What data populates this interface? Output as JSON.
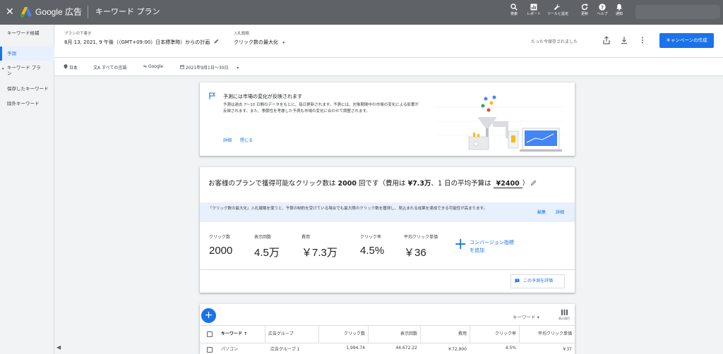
{
  "topbar": {
    "close_glyph": "✕",
    "brand": "Google 広告",
    "tool_name": "キーワード プラン",
    "icons": [
      {
        "name": "search-icon",
        "label": "検索"
      },
      {
        "name": "reports-icon",
        "label": "レポート"
      },
      {
        "name": "tools-icon",
        "label": "ツールと設定"
      },
      {
        "name": "refresh-icon",
        "label": "更新"
      },
      {
        "name": "help-icon",
        "label": "ヘルプ"
      },
      {
        "name": "notifications-icon",
        "label": "通知"
      }
    ],
    "logo_colors": {
      "blue": "#4285f4",
      "yellow": "#fbbc04",
      "green": "#34a853"
    }
  },
  "sidebar": {
    "items": [
      {
        "label": "キーワード候補"
      },
      {
        "label": "予測"
      },
      {
        "label": "キーワード プラン"
      },
      {
        "label": "保存したキーワード"
      },
      {
        "label": "除外キーワード"
      }
    ],
    "collapse_glyph": "◀"
  },
  "header": {
    "plan_label": "プランの下書き",
    "plan_title": "8月 13, 2021, 9 午後（（GMT+09:00）日本標準時）からの計画",
    "bid_label": "入札戦略",
    "bid_value": "クリック数の最大化",
    "saved_text": "たった今保存されました",
    "create_button": "キャンペーンの作成",
    "accent": "#1a73e8"
  },
  "filters": {
    "location": "日本",
    "language": "すべての言語",
    "network": "Google",
    "date_range": "2021年9月1日〜30日"
  },
  "info_card": {
    "title": "予測には市場の変化が反映されます",
    "body": "予測は過去 7〜10 日間のデータをもとに、毎日更新されます。予測には、対象期間中の市場の変化による影響が反映されます。また、季節性を考慮した予測も市場の変化に合わせて調整されます。",
    "details_link": "詳細",
    "close_link": "閉じる"
  },
  "forecast": {
    "headline_prefix": "お客様のプランで獲得可能なクリック数は",
    "headline_clicks": "2000",
    "headline_mid1": "回です（費用は",
    "headline_cost": "¥7.3万",
    "headline_mid2": "、1 日の平均予算は",
    "headline_budget": "¥2400",
    "headline_suffix": "）",
    "banner_text": "「クリック数の最大化」入札戦略を使うと、予算の制約を受けている場合でも最大限のクリック数を獲得し、見込まれる成果を達成できる可能性が高まります。",
    "banner_edit": "編集",
    "banner_details": "詳細",
    "metrics": [
      {
        "label": "クリック数",
        "value": "2000"
      },
      {
        "label": "表示回数",
        "value": "4.5万"
      },
      {
        "label": "費用",
        "value": "￥7.3万"
      },
      {
        "label": "クリック率",
        "value": "4.5%"
      },
      {
        "label": "平均クリック単価",
        "value": "￥36"
      }
    ],
    "conversion_plus": "+",
    "conversion_line1": "コンバージョン指標",
    "conversion_line2": "を追加",
    "rate_button": "この予測を評価"
  },
  "table": {
    "add_glyph": "+",
    "keyword_selector": "キーワード ▾",
    "columns_icon_label": "表示項目",
    "headers": [
      "キーワード ↑",
      "広告グループ",
      "クリック数",
      "表示回数",
      "費用",
      "クリック率",
      "平均クリック単価"
    ],
    "rows": [
      [
        "パソコン",
        "広告グループ 1",
        "1,994.74",
        "44,672.22",
        "￥72,900",
        "4.5%",
        "￥37"
      ]
    ]
  }
}
